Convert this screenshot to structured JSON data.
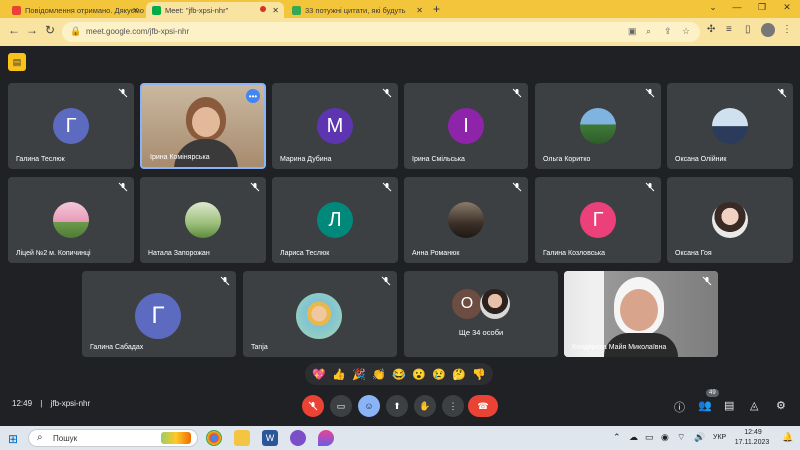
{
  "browser": {
    "tabs": [
      {
        "title": "Повідомлення отримано. Дякуємо",
        "icon": "gmail-icon"
      },
      {
        "title": "Meet: \"jfb-xpsi-nhr\"",
        "icon": "meet-icon",
        "active": true
      },
      {
        "title": "33 потужні цитати, які будуть",
        "icon": "site-icon"
      }
    ],
    "url": "meet.google.com/jfb-xpsi-nhr"
  },
  "participants": [
    {
      "name": "Галина Теслюк",
      "initial": "Г",
      "color": "#5c6bc0"
    },
    {
      "name": "Ірина Комінярська",
      "initial": "",
      "color": "",
      "photo": true,
      "active": true
    },
    {
      "name": "Марина Дубина",
      "initial": "М",
      "color": "#5e35b1"
    },
    {
      "name": "Ірина Смільська",
      "initial": "І",
      "color": "#8e24aa"
    },
    {
      "name": "Ольга Коритко",
      "initial": "",
      "color": "",
      "photo": true
    },
    {
      "name": "Оксана Олійник",
      "initial": "",
      "color": "",
      "photo": true
    },
    {
      "name": "Ліцей №2 м. Копичинці",
      "initial": "",
      "color": "",
      "photo": true
    },
    {
      "name": "Натала Запорожан",
      "initial": "",
      "color": "",
      "photo": true
    },
    {
      "name": "Лариса Теслюк",
      "initial": "Л",
      "color": "#00897b"
    },
    {
      "name": "Анна Романюк",
      "initial": "",
      "color": "",
      "photo": true
    },
    {
      "name": "Галина Козловська",
      "initial": "Г",
      "color": "#ec407a"
    },
    {
      "name": "Оксана Гоя",
      "initial": "",
      "color": "",
      "photo": true
    },
    {
      "name": "Галина Сабадах",
      "initial": "Г",
      "color": "#5c6bc0"
    },
    {
      "name": "Tanja",
      "initial": "",
      "color": "",
      "photo": true
    },
    {
      "name": "Ще 34 особи",
      "initial": "О",
      "color": "#6d4c41"
    },
    {
      "name": "Кондирєва Майя Миколаївна",
      "initial": "",
      "color": "",
      "photo": true
    }
  ],
  "reactions": [
    "💖",
    "👍",
    "🎉",
    "👏",
    "😂",
    "😮",
    "😢",
    "🤔",
    "👎"
  ],
  "controls": {
    "time": "12:49",
    "separator": "|",
    "meeting_code": "jfb-xpsi-nhr",
    "people_count": "49"
  },
  "taskbar": {
    "search_placeholder": "Пошук",
    "lang": "УКР",
    "time": "12:49",
    "date": "17.11.2023"
  }
}
